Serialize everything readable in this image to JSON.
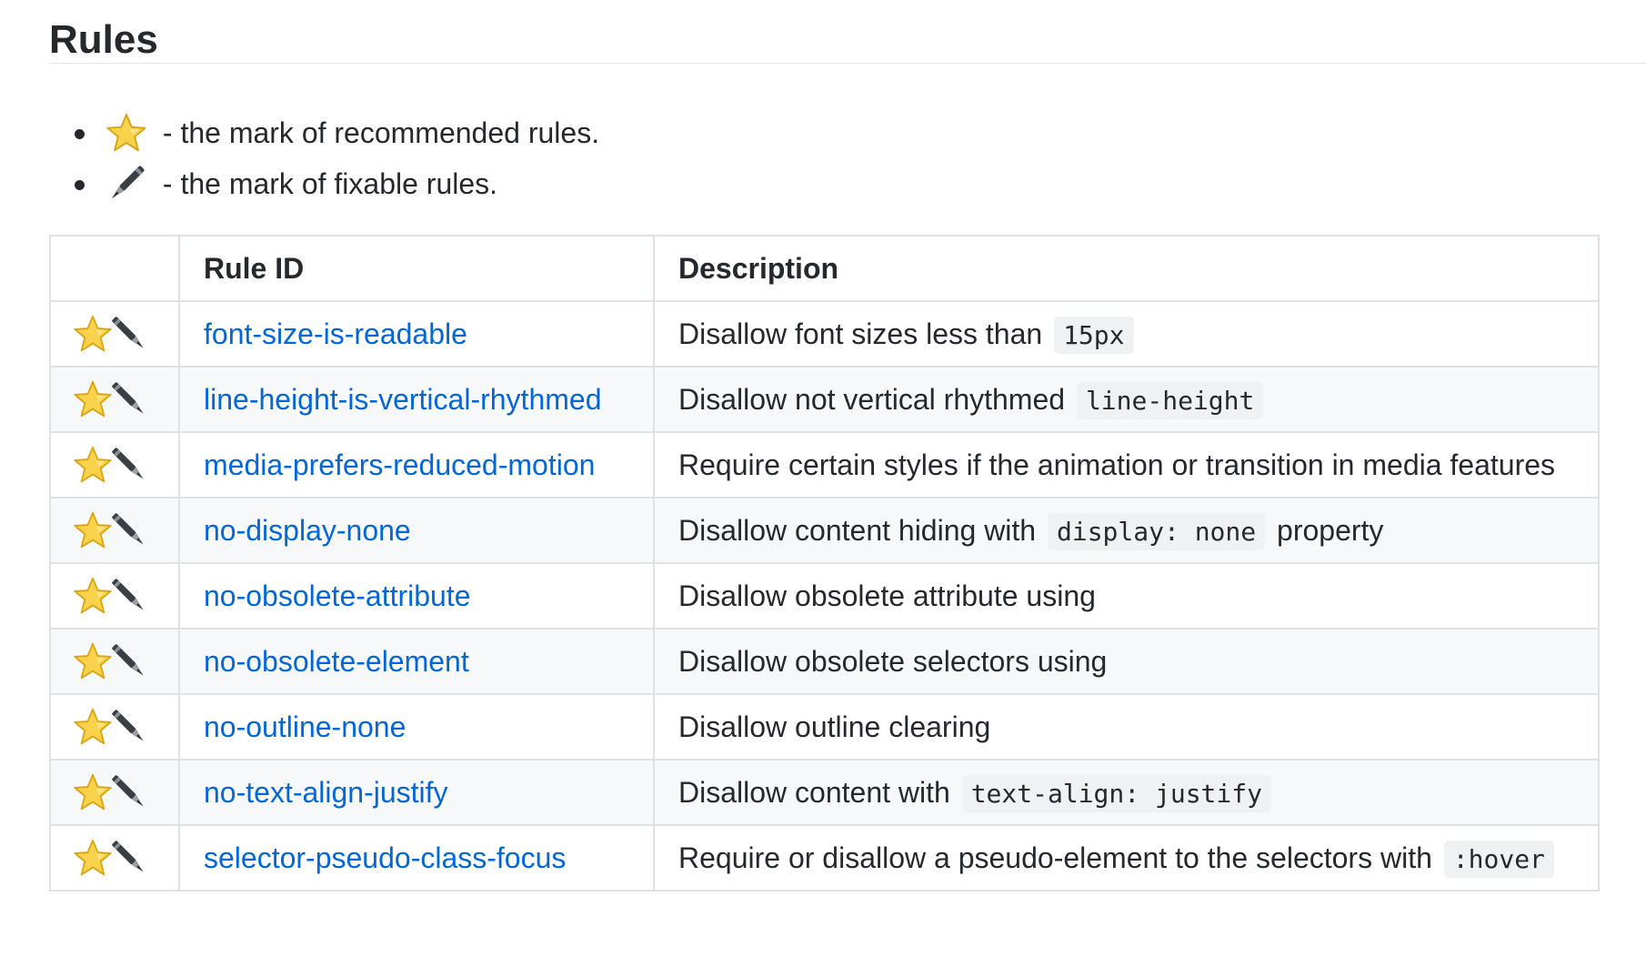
{
  "title": "Rules",
  "legend": [
    {
      "icon": "star-icon",
      "text": " - the mark of recommended rules."
    },
    {
      "icon": "pen-icon",
      "text": " - the mark of fixable rules."
    }
  ],
  "table": {
    "headers": {
      "marks": "",
      "rule_id": "Rule ID",
      "description": "Description"
    },
    "rows": [
      {
        "recommended": false,
        "fixable": false,
        "rule_id": "font-size-is-readable",
        "desc": "Disallow font sizes less than ",
        "code": "15px",
        "suffix": ""
      },
      {
        "recommended": false,
        "fixable": false,
        "rule_id": "line-height-is-vertical-rhythmed",
        "desc": "Disallow not vertical rhythmed ",
        "code": "line-height",
        "suffix": ""
      },
      {
        "recommended": true,
        "fixable": true,
        "rule_id": "media-prefers-reduced-motion",
        "desc": "Require certain styles if the animation or transition in media features",
        "code": "",
        "suffix": ""
      },
      {
        "recommended": false,
        "fixable": false,
        "rule_id": "no-display-none",
        "desc": "Disallow content hiding with ",
        "code": "display: none",
        "suffix": " property"
      },
      {
        "recommended": false,
        "fixable": false,
        "rule_id": "no-obsolete-attribute",
        "desc": "Disallow obsolete attribute using",
        "code": "",
        "suffix": ""
      },
      {
        "recommended": false,
        "fixable": false,
        "rule_id": "no-obsolete-element",
        "desc": "Disallow obsolete selectors using",
        "code": "",
        "suffix": ""
      },
      {
        "recommended": true,
        "fixable": false,
        "rule_id": "no-outline-none",
        "desc": "Disallow outline clearing",
        "code": "",
        "suffix": ""
      },
      {
        "recommended": false,
        "fixable": false,
        "rule_id": "no-text-align-justify",
        "desc": "Disallow content with ",
        "code": "text-align: justify",
        "suffix": ""
      },
      {
        "recommended": true,
        "fixable": true,
        "rule_id": "selector-pseudo-class-focus",
        "desc": "Require or disallow a pseudo-element to the selectors with ",
        "code": ":hover",
        "suffix": ""
      }
    ]
  },
  "colors": {
    "link": "#0366d6",
    "text": "#24292e",
    "border": "#dfe2e5",
    "stripe": "#f6f8fa",
    "star": "#f6c531"
  }
}
